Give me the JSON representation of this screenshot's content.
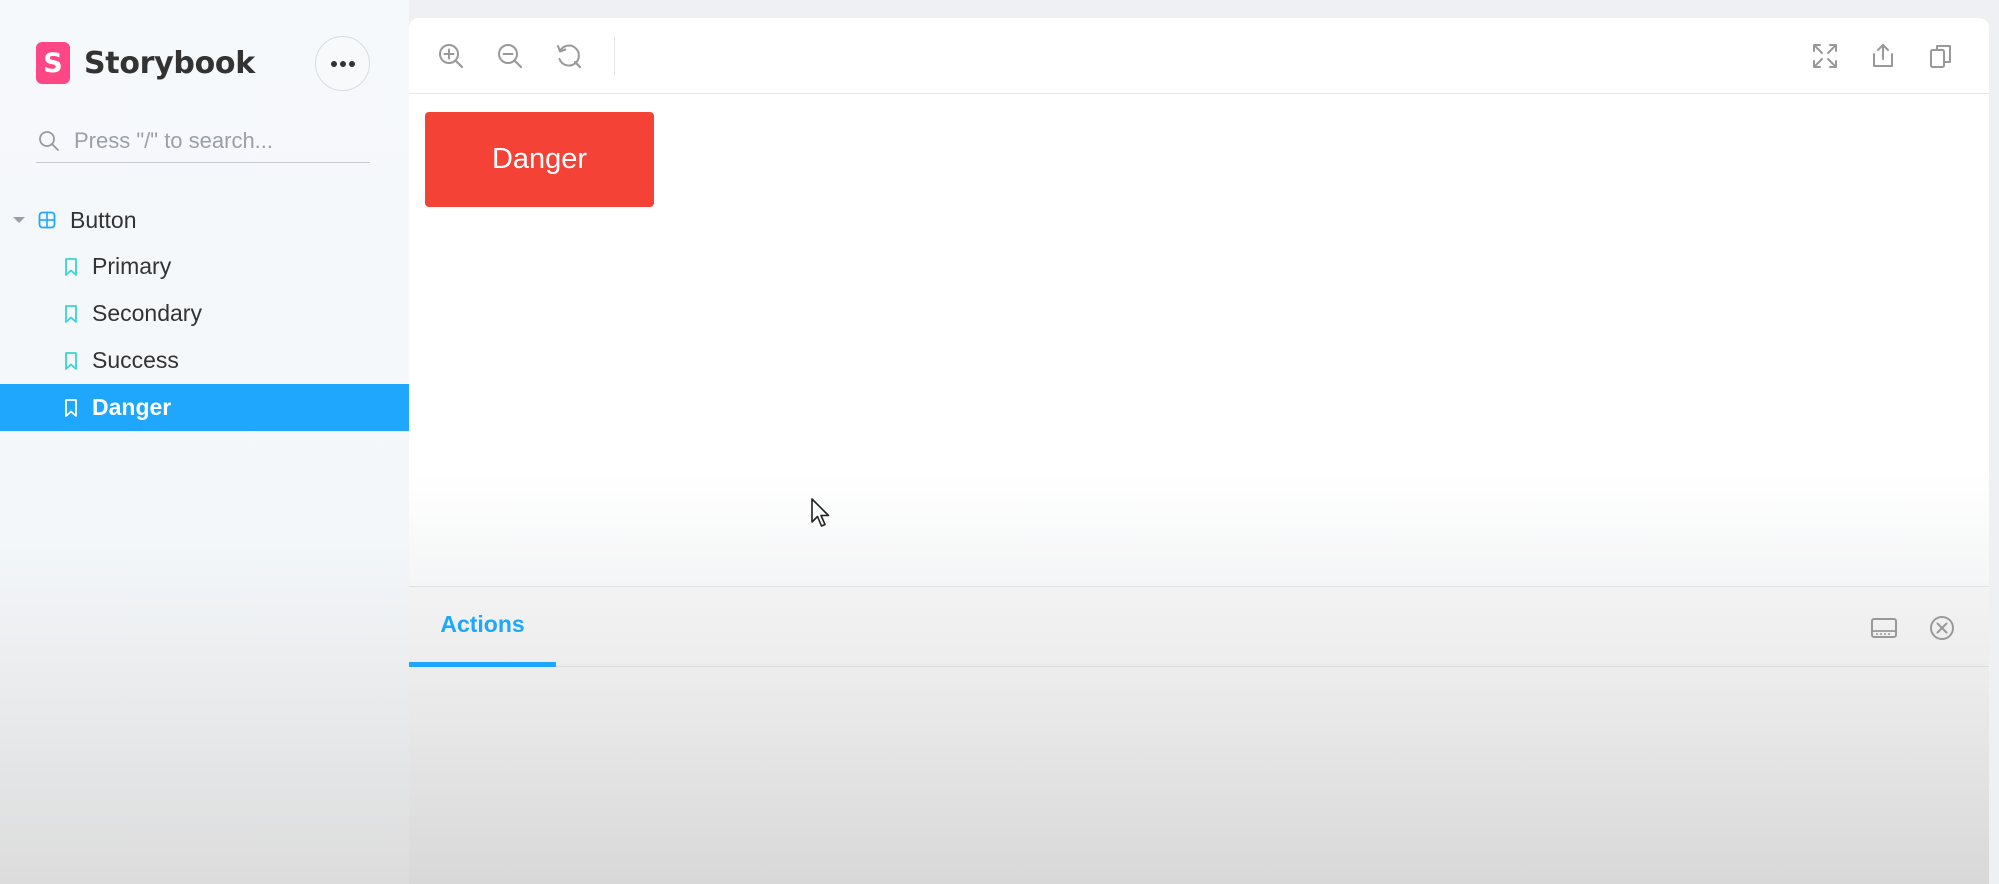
{
  "sidebar": {
    "brand": {
      "logo_letter": "S",
      "name": "Storybook"
    },
    "search": {
      "placeholder": "Press \"/\" to search..."
    },
    "tree": {
      "group": {
        "label": "Button"
      },
      "items": [
        {
          "label": "Primary",
          "selected": false
        },
        {
          "label": "Secondary",
          "selected": false
        },
        {
          "label": "Success",
          "selected": false
        },
        {
          "label": "Danger",
          "selected": true
        }
      ]
    }
  },
  "toolbar": {
    "icons": [
      "zoom-in-icon",
      "zoom-out-icon",
      "reset-zoom-icon",
      "fullscreen-icon",
      "share-icon",
      "copy-icon"
    ]
  },
  "canvas": {
    "story_button": {
      "label": "Danger",
      "color": "#f44336"
    }
  },
  "panel": {
    "tabs": [
      {
        "label": "Actions",
        "active": true
      }
    ]
  },
  "colors": {
    "accent": "#1ea7fd",
    "brand": "#ff4785",
    "danger": "#f44336",
    "story_icon": "#37d5d3"
  }
}
